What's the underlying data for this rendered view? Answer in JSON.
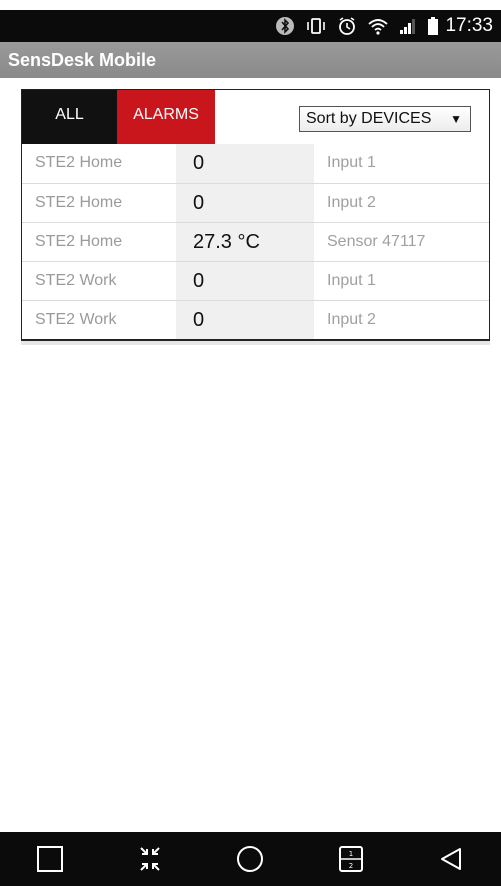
{
  "status_bar": {
    "time": "17:33",
    "icons": [
      "bluetooth-icon",
      "vibrate-icon",
      "alarm-clock-icon",
      "wifi-icon",
      "signal-icon",
      "battery-icon"
    ]
  },
  "app_bar": {
    "title": "SensDesk Mobile"
  },
  "tabs": [
    {
      "label": "ALL",
      "color": "#111111"
    },
    {
      "label": "ALARMS",
      "color": "#c8161c"
    }
  ],
  "sort": {
    "selected": "Sort by DEVICES"
  },
  "rows": [
    {
      "device": "STE2 Home",
      "value": "0",
      "input": "Input 1"
    },
    {
      "device": "STE2 Home",
      "value": "0",
      "input": "Input 2"
    },
    {
      "device": "STE2 Home",
      "value": "27.3 °C",
      "input": "Sensor 47117"
    },
    {
      "device": "STE2 Work",
      "value": "0",
      "input": "Input 1"
    },
    {
      "device": "STE2 Work",
      "value": "0",
      "input": "Input 2"
    }
  ],
  "nav_bar": {
    "icons": [
      "recent-apps-icon",
      "minimize-icon",
      "home-icon",
      "dual-window-icon",
      "back-icon"
    ]
  }
}
